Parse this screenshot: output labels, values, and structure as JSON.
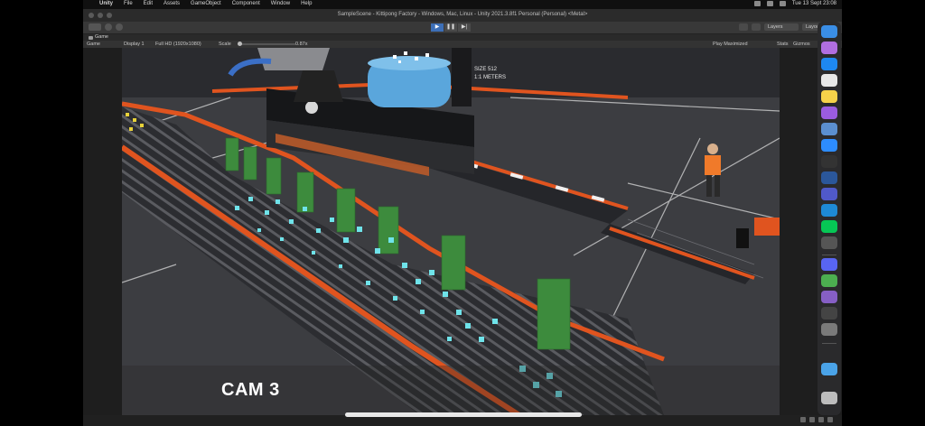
{
  "menubar": {
    "app_name": "Unity",
    "menu_items": [
      "File",
      "Edit",
      "Assets",
      "GameObject",
      "Component",
      "Window",
      "Help"
    ],
    "clock": "Tue 13 Sept 23:08"
  },
  "window": {
    "title": "SampleScene - Kittipong Factory - Windows, Mac, Linux - Unity 2021.3.8f1 Personal (Personal) <Metal>"
  },
  "toolbar": {
    "play_icon": "▶",
    "pause_icon": "❚❚",
    "step_icon": "▶|",
    "layers_label": "Layers",
    "layout_label": "Layout"
  },
  "game_tab": {
    "label": "Game"
  },
  "game_bar": {
    "view_select": "Game",
    "display_select": "Display 1",
    "resolution_select": "Full HD (1920x1080)",
    "scale_label": "Scale",
    "scale_value": "0.87x",
    "play_mode_select": "Play Maximized",
    "stats_label": "Stats",
    "gizmos_label": "Gizmos"
  },
  "scene": {
    "camera_label": "CAM 3",
    "floor_marking": "1:1 METERS",
    "floor_marking_2": "SIZE 512"
  },
  "colors": {
    "accent_play": "#3d6fb7",
    "conveyor_rail": "#e0541f",
    "cube_green": "#3d8b3d",
    "particle_cyan": "#6fe3ea",
    "tank_blue": "#5aa6dc"
  },
  "dock": {
    "icons": [
      "finder-icon",
      "launchpad-icon",
      "app-store-icon",
      "chrome-icon",
      "notes-icon",
      "affinity-icon",
      "davinci-icon",
      "zoom-icon",
      "terminal-icon",
      "word-icon",
      "teams-icon",
      "vscode-icon",
      "line-icon",
      "unity-hub-icon",
      "discord-icon",
      "utorrent-icon",
      "visual-studio-icon",
      "unity-icon",
      "system-prefs-icon",
      "downloads-folder-icon",
      "trash-icon"
    ]
  }
}
